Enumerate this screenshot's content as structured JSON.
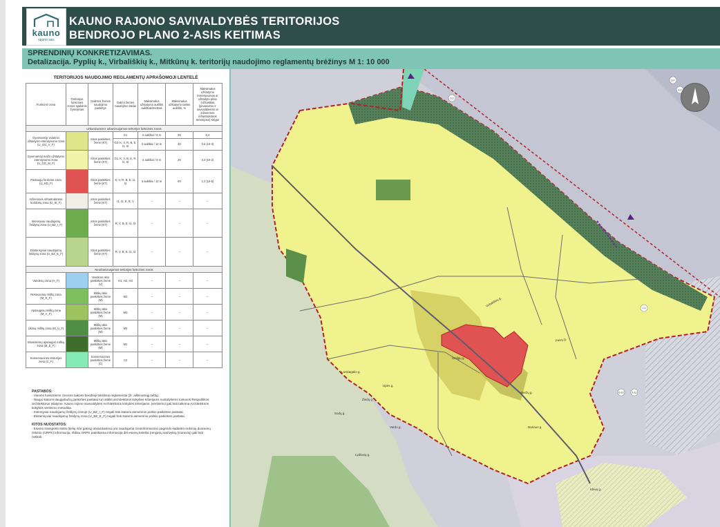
{
  "header": {
    "logo_text": "kauno",
    "logo_subtext": "rajono sav.",
    "title_line1": "KAUNO RAJONO SAVIVALDYBĖS TERITORIJOS",
    "title_line2": "BENDROJO PLANO 2-ASIS KEITIMAS"
  },
  "subheader": {
    "line1": "SPRENDINIŲ KONKRETIZAVIMAS.",
    "line2": "Detalizacija. Pyplių k., Virbališkių k., Mitkūnų k. teritorijų naudojimo reglamentų brėžinys M 1: 10 000"
  },
  "legend": {
    "title": "TERITORIJOS NAUDOJIMO REGLAMENTŲ APRAŠOMOJI LENTELĖ",
    "columns": [
      "Funkcinė zona",
      "Teritorijos funkcinės zonos spalvinis žymėjimas",
      "Galimos žemės naudojimo paskirtys",
      "Galimi žemės naudojimo būdai",
      "Maksimalus užstatymo aukštis aukštais/metrais",
      "Maksimalus užstatymo tankis aukštis, %",
      "Maksimalus užstatymo intensyvumas ar užstatyto ploto (Užrastitas ljsnaravimo ir savivaldiesms ar inžinerinės infrastruktūros teritorijose) sklype"
    ],
    "group1": "Urbanizuotos ir urbanizuojamos teritorijos funkcinės zonos",
    "group2": "Neurbanizuojamos teritorijos funkcinės zonos",
    "rows": [
      {
        "zone": "Gyvenamoji vidutinio užstatymo intensyvumo zona (U_GG_V_F)",
        "color": "#dfe68a",
        "purpose": "Kitos paskirties žemė (KT)",
        "uses": [
          "G1",
          "G2, K, V, R, B, E, I1, I2"
        ],
        "height": [
          "2 aukštai / 9 m",
          "3 aukštai / 12 m"
        ],
        "density": [
          "30",
          "40"
        ],
        "intensity": [
          "0,4",
          "0,6 (UI-4)"
        ]
      },
      {
        "zone": "Gyvenamoji mažo užstatymo intensyvumo zona (U_GG_M_F)",
        "color": "#f2f2a9",
        "purpose": "Kitos paskirties žemė (KT)",
        "uses": [
          "G1, K, V, B, E, R, I1, I2"
        ],
        "height": [
          "2 aukštai / 9 m"
        ],
        "density": [
          "20"
        ],
        "intensity": [
          "0,3 (UI-2)"
        ]
      },
      {
        "zone": "Paslaugų funkcinė zona (U_KD_F)",
        "color": "#e05353",
        "purpose": "Kitos paskirties žemė (KT)",
        "uses": [
          "K, V, R, B, E, I1, I2"
        ],
        "height": [
          "3 aukštai / 12 m"
        ],
        "density": [
          "60"
        ],
        "intensity": [
          "1,2 (UI-5)"
        ]
      },
      {
        "zone": "Inžinerinės infrastruktūros koridorių zona (U_IK_F)",
        "color": "#efefe6",
        "purpose": "Kitos paskirties žemė (KT)",
        "uses": [
          "I1, I2, E, B, V"
        ],
        "height": [
          "–"
        ],
        "density": [
          "–"
        ],
        "intensity": [
          "–"
        ]
      },
      {
        "zone": "Intensyviai naudojamų želdynų zona (U_BZ_I_F)",
        "color": "#6dab4c",
        "purpose": "Kitos paskirties žemė (KT)",
        "uses": [
          "R, V, B, E, I1, I2"
        ],
        "height": [
          "–"
        ],
        "density": [
          "–"
        ],
        "intensity": [
          "–"
        ]
      },
      {
        "zone": "Ekstensyviai naudojamų želdynų zona (U_BZ_E_F)",
        "color": "#b9d58e",
        "purpose": "Kitos paskirties žemė (KT)",
        "uses": [
          "R, V, B, E, I1, I2"
        ],
        "height": [
          "–"
        ],
        "density": [
          "–"
        ],
        "intensity": [
          "–"
        ]
      }
    ],
    "rows2": [
      {
        "zone": "Vandenų zona (H_F)",
        "color": "#9dcff0",
        "purpose": "Vandens ūkio paskirties žemė (V)",
        "uses": [
          "H1, H2, H3"
        ],
        "height": [
          "–"
        ],
        "density": [
          "–"
        ],
        "intensity": [
          "–"
        ]
      },
      {
        "zone": "Rekreacinių miškų zona (M_R_F)",
        "color": "#7dbf5c",
        "purpose": "Miškų ūkio paskirties žemė (M)",
        "uses": [
          "M2"
        ],
        "height": [
          "–"
        ],
        "density": [
          "–"
        ],
        "intensity": [
          "–"
        ]
      },
      {
        "zone": "Apsauginių miškų zona (M_A_F)",
        "color": "#9cc35e",
        "purpose": "Miškų ūkio paskirties žemė (M)",
        "uses": [
          "M3"
        ],
        "height": [
          "–"
        ],
        "density": [
          "–"
        ],
        "intensity": [
          "–"
        ]
      },
      {
        "zone": "Ūkinių miškų zona (M_U_F)",
        "color": "#4f8f45",
        "purpose": "Miškų ūkio paskirties žemė (M)",
        "uses": [
          "M4"
        ],
        "height": [
          "–"
        ],
        "density": [
          "–"
        ],
        "intensity": [
          "–"
        ]
      },
      {
        "zone": "Ekosistemų apsaugos miškų zona (M_E_F)",
        "color": "#3f6d2c",
        "purpose": "Miškų ūkio paskirties žemė (M)",
        "uses": [
          "M1"
        ],
        "height": [
          "–"
        ],
        "density": [
          "–"
        ],
        "intensity": [
          "–"
        ]
      },
      {
        "zone": "Konservacinės teritorijos zona (C_F)",
        "color": "#86eab6",
        "purpose": "Konservacinės paskirties žemė (C)",
        "uses": [
          "C2"
        ],
        "height": [
          "–"
        ],
        "density": [
          "–"
        ],
        "intensity": [
          "–"
        ]
      }
    ]
  },
  "notes": {
    "heading1": "PASTABOS:",
    "items1": [
      "- Visoms funkcinėms zonoms taikomi bendrieji teksliniai reglamentai (žr. aiškinamąjį raštą).",
      "- Naujai statomi daugiabučių paskirties pastatai turi atitikti architektūros kokybės kriterijams nustatytiems Lietuvos Respublikos architektūros įstatyme. Kauno rajono savivaldybės Architektūros kokybės kriterijams. Įvertinimui gali būti taikoma Architektūros kokybės vertinimo metodika.",
      "- Intensyviai naudojamų želdynų zonoje (U_BZ_I_F) negali būti statomi asmeninio poilsio paskirties pastatai.",
      "- Ekstensyviai naudojamų želdynų zona (U_BZ_E_F) negali būti statomi asmeninio poilsio paskirties pastatai."
    ],
    "heading2": "KITOS NUOSTATOS:",
    "items2": [
      "- Esamo transporto tinklo (kelių ir/ar gatvių) atvaizdavimui yra naudojama Geoinformacinio pagrindo kadastro erdvinių duomenų rinkinio (GRPK) informacija. Išdiau GRPK pateikiama informacija dėl esamų keletlai (renginių santvykių (moraviių) gali būti netiksli."
    ]
  },
  "map": {
    "colors": {
      "residential": "#f0f28e",
      "residential_dense": "#d9d86b",
      "services": "#e05353",
      "forest": "#4a7a49",
      "water": "#9dcff0",
      "river": "#c8cbd8",
      "meadow": "#cfe3b8",
      "boundary": "#b51f2a"
    },
    "labels": [
      "Virbališkių g.",
      "Pievų g.",
      "Smilgų g.",
      "Lankiagalio g.",
      "Upės g.",
      "Žiedų g.",
      "Beržų g.",
      "Dariaus g.",
      "Sodų g.",
      "Vardo g.",
      "Lydlavių g.",
      "Klevų g."
    ],
    "markers": [
      "6.3",
      "7.4",
      "6.10",
      "6.11",
      "6.4",
      "8.2"
    ]
  },
  "compass_icon": "compass-icon"
}
